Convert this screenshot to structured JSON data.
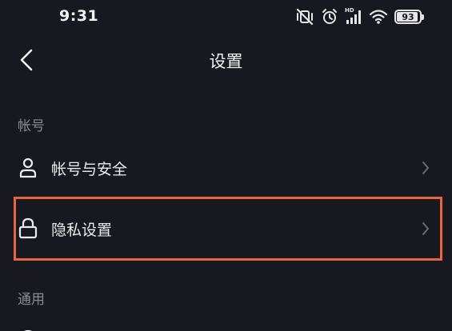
{
  "status_bar": {
    "time": "9:31",
    "icons": [
      "vibrate-off-icon",
      "alarm-icon",
      "hd-signal-icon",
      "wifi-icon",
      "battery-icon"
    ],
    "hd_label": "HD",
    "battery_level": "93",
    "battery_fraction": 0.93
  },
  "nav": {
    "back_icon": "chevron-left-icon",
    "title": "设置"
  },
  "sections": [
    {
      "label": "帐号",
      "items": [
        {
          "label": "帐号与安全",
          "icon": "user-icon"
        },
        {
          "label": "隐私设置",
          "icon": "lock-icon",
          "highlighted": true
        }
      ]
    },
    {
      "label": "通用",
      "items": []
    }
  ],
  "colors": {
    "background": "#181920",
    "text_primary": "#ececee",
    "text_secondary": "#8a8b93",
    "highlight_border": "#e8643c",
    "chevron": "#6b6c74"
  }
}
